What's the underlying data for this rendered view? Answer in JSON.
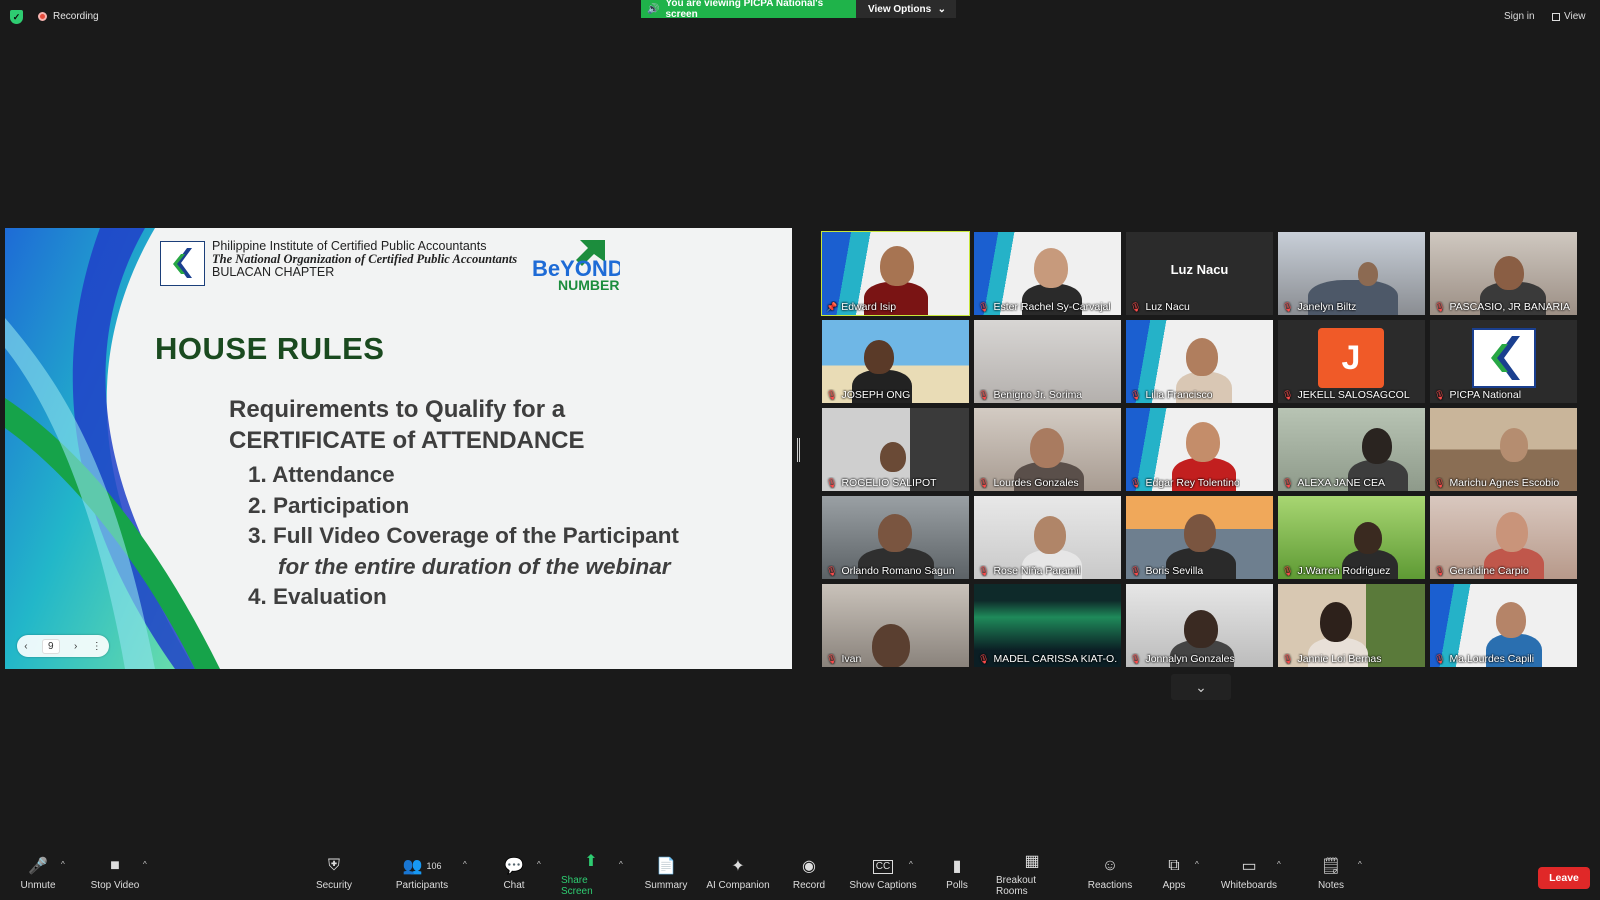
{
  "topbar": {
    "recording": "Recording",
    "viewing_banner": "You are viewing PICPA National's screen",
    "view_options": "View Options",
    "sign_in": "Sign in",
    "view": "View"
  },
  "slide": {
    "org_line1": "Philippine Institute of Certified Public Accountants",
    "org_line2": "The National Organization of Certified Public Accountants",
    "org_line3": "BULACAN CHAPTER",
    "brand": "BeYOND NUMBERS",
    "title": "HOUSE RULES",
    "req_line1": "Requirements to Qualify for a",
    "req_line2": "CERTIFICATE of ATTENDANCE",
    "rules": [
      "1. Attendance",
      "2. Participation",
      "3. Full Video Coverage of the Participant",
      "for the entire duration of the webinar",
      "4. Evaluation"
    ],
    "page_number": "9"
  },
  "participants": [
    {
      "name": "Edward Isip"
    },
    {
      "name": "Ester Rachel Sy-Carvajal"
    },
    {
      "name": "Luz Nacu"
    },
    {
      "name": "Janelyn Biltz"
    },
    {
      "name": "PASCASIO, JR BANARIA"
    },
    {
      "name": "JOSEPH ONG"
    },
    {
      "name": "Benigno Jr. Sorima"
    },
    {
      "name": "Lilia Francisco"
    },
    {
      "name": "JEKELL SALOSAGCOL"
    },
    {
      "name": "PICPA National"
    },
    {
      "name": "ROGELIO SALIPOT"
    },
    {
      "name": "Lourdes Gonzales"
    },
    {
      "name": "Edgar Rey Tolentino"
    },
    {
      "name": "ALEXA JANE CEA"
    },
    {
      "name": "Marichu Agnes Escobio"
    },
    {
      "name": "Orlando Romano Sagun"
    },
    {
      "name": "Rose Niña Paramil"
    },
    {
      "name": "Boris Sevilla"
    },
    {
      "name": "J.Warren Rodriguez"
    },
    {
      "name": "Geraldine Carpio"
    },
    {
      "name": "Ivan"
    },
    {
      "name": "MADEL CARISSA KIAT-O..."
    },
    {
      "name": "Jonnalyn Gonzales"
    },
    {
      "name": "Jannie Loi Bernas"
    },
    {
      "name": "Ma.Lourdes Capili"
    }
  ],
  "luz_display_name": "Luz Nacu",
  "jekell_initial": "J",
  "toolbar": {
    "unmute": "Unmute",
    "stop_video": "Stop Video",
    "security": "Security",
    "participants": "Participants",
    "participants_count": "106",
    "chat": "Chat",
    "share_screen": "Share Screen",
    "summary": "Summary",
    "ai_companion": "AI Companion",
    "record": "Record",
    "show_captions": "Show Captions",
    "polls": "Polls",
    "breakout_rooms": "Breakout Rooms",
    "reactions": "Reactions",
    "apps": "Apps",
    "whiteboards": "Whiteboards",
    "notes": "Notes",
    "leave": "Leave"
  },
  "colors": {
    "share_green": "#2ecc71",
    "leave_red": "#e02828",
    "active_speaker": "#c8e63a"
  }
}
